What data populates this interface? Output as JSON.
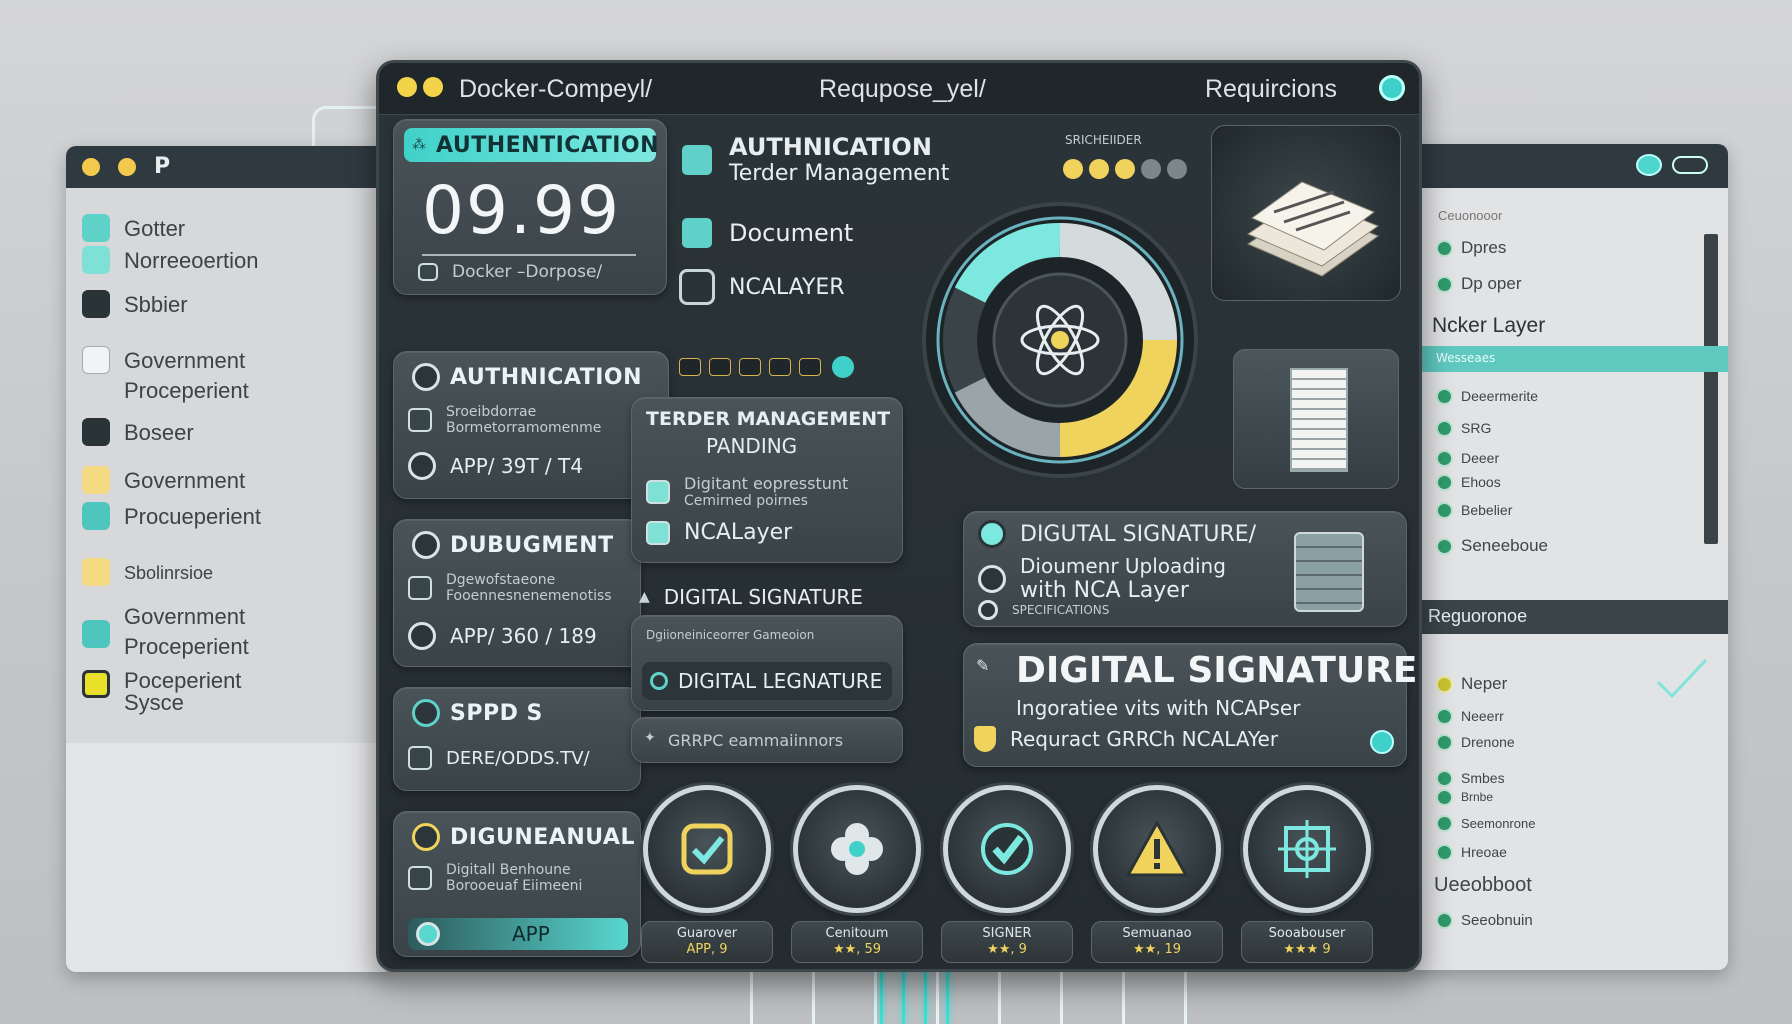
{
  "main_window": {
    "tabs": [
      "Docker-Compeyl/",
      "Requpose_yel/",
      "Requircions"
    ],
    "auth_card": {
      "header": "AUTHENTICATION",
      "value": "09.99",
      "footer": "Docker –Dorpose/"
    },
    "top_menu": {
      "title_line1": "AUTHNICATION",
      "title_line2": "Terder Management",
      "item_document": "Document",
      "item_ncalayer": "NCALAYER"
    },
    "authnication_card": {
      "title": "AUTHNICATION",
      "line1": "Sroeibdorrae",
      "line2": "Bormetorramomenme",
      "app": "APP/ 39T / T4"
    },
    "dubugment_card": {
      "title": "DUBUGMENT",
      "line1": "Dgewofstaeone",
      "line2": "Fooennesnenemenotiss",
      "app": "APP/ 360 / 189"
    },
    "sppds_card": {
      "title": "SPPD S",
      "path": "DERE/ODDS.TV/"
    },
    "diguneanual_card": {
      "title": "DIGUNEANUAL",
      "line1": "Digitall Benhoune",
      "line2": "Borooeuaf Eiimeeni",
      "app": "APP"
    },
    "tender_card": {
      "title": "TERDER MANAGEMENT",
      "subtitle": "PANDING",
      "item1": "Digitant eopresstunt",
      "item1_sub": "Cemirned poirnes",
      "item2": "NCALayer"
    },
    "digital_sig_label": "DIGITAL SIGNATURE",
    "digital_lignature": {
      "caption": "Dgiioneiniceorrer Gameoion",
      "label": "DIGITAL LEGNATURE"
    },
    "grpc_bar": "GRRPC eammaiinnors",
    "upload_card": {
      "title": "DIGUTAL SIGNATURE/",
      "line1": "Dioumenr Uploading",
      "line2": "with NCA Layer",
      "footer": "SPECIFICATIONS"
    },
    "digital_signature_card": {
      "title": "DIGITAL SIGNATURE",
      "line1": "Ingoratiee vits with NCAPser",
      "line2": "Requract GRRCh NCALAYer"
    },
    "badges": [
      {
        "label": "Guarover",
        "sub": "APP, 9"
      },
      {
        "label": "Cenitoum",
        "sub": "★★, 59"
      },
      {
        "label": "SIGNER",
        "sub": "★★, 9"
      },
      {
        "label": "Semuanao",
        "sub": "★★, 19"
      },
      {
        "label": "Sooabouser",
        "sub": "★★★ 9"
      }
    ],
    "small_header_label": "SRICHEIIDER"
  },
  "left_window": {
    "title": "P",
    "items": [
      {
        "label": "Gotter",
        "icon": "teal-square-icon"
      },
      {
        "label": "Norreeoertion",
        "icon": "teal-square-icon"
      },
      {
        "label": "Sbbier",
        "icon": "dark-square-icon"
      },
      {
        "label": "Government\nProceperient",
        "icon": "light-square-icon"
      },
      {
        "label": "Boseer",
        "icon": "dark-square-icon"
      },
      {
        "label": "Government",
        "icon": "yellow-square-icon"
      },
      {
        "label": "Procueperient",
        "icon": "teal-square-icon"
      },
      {
        "label": "Sbolinrsioe",
        "icon": "yellow-square-icon"
      },
      {
        "label": "Government\nProceperient",
        "icon": "teal-square-icon"
      },
      {
        "label": "Poceperient\nSysce",
        "icon": "yellow-square-icon"
      }
    ]
  },
  "right_window": {
    "items_top": [
      "Ceuonooor",
      "Dpres",
      "Dp oper"
    ],
    "selected_label": "Ncker Layer",
    "selected_sub": "Wesseaes",
    "items_mid": [
      "Deeermerite",
      "SRG",
      "Deeer",
      "Ehoos",
      "Bebelier",
      "Seneeboue"
    ],
    "section_header": "Reguoronoe",
    "items_bottom": [
      "Neper",
      "Neeerr",
      "Drenone",
      "Smbes",
      "Brnbe",
      "Seemonrone",
      "Hreoae",
      "Ueeobboot",
      "Seeobnuin"
    ]
  },
  "colors": {
    "accent_cyan": "#3fd1c9",
    "accent_yellow": "#f0d35c",
    "panel_dark": "#2b3438"
  }
}
